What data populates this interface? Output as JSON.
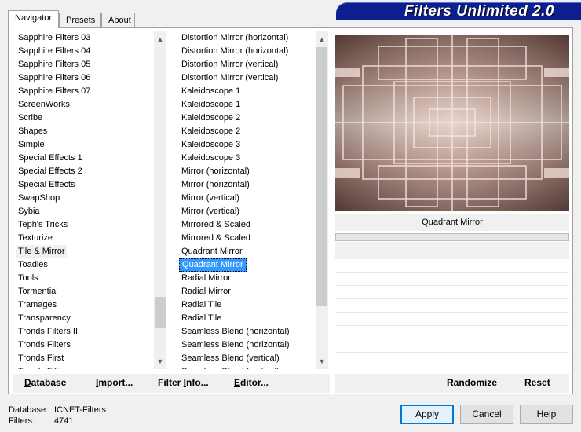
{
  "tabs": [
    {
      "label": "Navigator",
      "active": true
    },
    {
      "label": "Presets",
      "active": false
    },
    {
      "label": "About",
      "active": false
    }
  ],
  "banner": {
    "title": "Filters Unlimited 2.0"
  },
  "categories": {
    "items": [
      "Sapphire Filters 03",
      "Sapphire Filters 04",
      "Sapphire Filters 05",
      "Sapphire Filters 06",
      "Sapphire Filters 07",
      "ScreenWorks",
      "Scribe",
      "Shapes",
      "Simple",
      "Special Effects 1",
      "Special Effects 2",
      "Special Effects",
      "SwapShop",
      "Sybia",
      "Teph's Tricks",
      "Texturize",
      "Tile & Mirror",
      "Toadies",
      "Tools",
      "Tormentia",
      "Tramages",
      "Transparency",
      "Tronds Filters II",
      "Tronds Filters",
      "Tronds First",
      "Tronds Filters"
    ],
    "focused": "Tile & Mirror"
  },
  "filters": {
    "items": [
      "Distortion Mirror (horizontal)",
      "Distortion Mirror (horizontal)",
      "Distortion Mirror (vertical)",
      "Distortion Mirror (vertical)",
      "Kaleidoscope 1",
      "Kaleidoscope 1",
      "Kaleidoscope 2",
      "Kaleidoscope 2",
      "Kaleidoscope 3",
      "Kaleidoscope 3",
      "Mirror (horizontal)",
      "Mirror (horizontal)",
      "Mirror (vertical)",
      "Mirror (vertical)",
      "Mirrored & Scaled",
      "Mirrored & Scaled",
      "Quadrant Mirror",
      "Quadrant Mirror",
      "Radial Mirror",
      "Radial Mirror",
      "Radial Tile",
      "Radial Tile",
      "Seamless Blend (horizontal)",
      "Seamless Blend (horizontal)",
      "Seamless Blend (vertical)",
      "Seamless Blend (vertical)"
    ],
    "selected_index": 17
  },
  "preview": {
    "filter_name": "Quadrant Mirror"
  },
  "toolbar": {
    "database": "Database",
    "import": "Import...",
    "filter_info": "Filter Info...",
    "editor": "Editor...",
    "randomize": "Randomize",
    "reset": "Reset"
  },
  "status": {
    "database_label": "Database:",
    "database_value": "ICNET-Filters",
    "filters_label": "Filters:",
    "filters_value": "4741"
  },
  "buttons": {
    "apply": "Apply",
    "cancel": "Cancel",
    "help": "Help"
  },
  "colors": {
    "banner": "#0b1f8e",
    "selection": "#3399ff",
    "preview": "#c9a79a"
  }
}
